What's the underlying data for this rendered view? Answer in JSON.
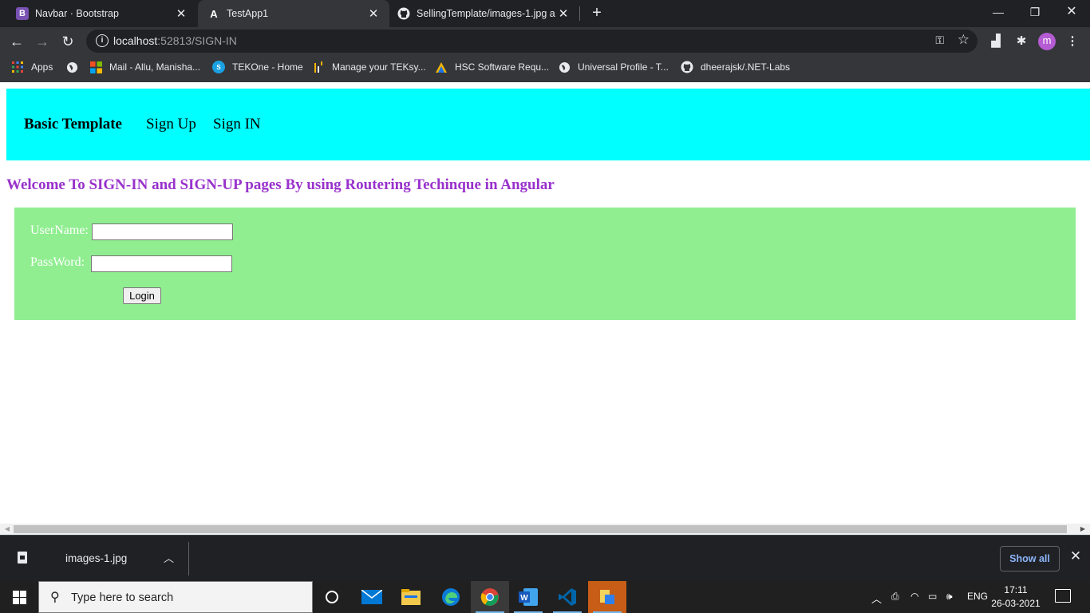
{
  "browser": {
    "tabs": [
      {
        "title": "Navbar · Bootstrap",
        "icon": "bootstrap-icon"
      },
      {
        "title": "TestApp1",
        "icon": "angular-icon"
      },
      {
        "title": "SellingTemplate/images-1.jpg at",
        "icon": "github-icon"
      }
    ],
    "url_host": "localhost",
    "url_rest": ":52813/SIGN-IN",
    "profile_initial": "m",
    "bookmarks": [
      "Apps",
      "Mail - Allu, Manisha...",
      "TEKOne - Home",
      "Manage your TEKsy...",
      "HSC Software Requ...",
      "Universal Profile - T...",
      "dheerajsk/.NET-Labs"
    ]
  },
  "page": {
    "brand": "Basic Template",
    "nav_links": [
      "Sign Up",
      "Sign IN"
    ],
    "heading": "Welcome To SIGN-IN and SIGN-UP pages By using Routering Techinque in Angular",
    "form": {
      "username_label": "UserName:",
      "password_label": "PassWord:",
      "username_value": "",
      "password_value": "",
      "login_label": "Login"
    },
    "colors": {
      "navbar": "#00ffff",
      "heading": "#9932cc",
      "form_bg": "#90ee90"
    }
  },
  "download_shelf": {
    "file_name": "images-1.jpg",
    "show_all": "Show all"
  },
  "taskbar": {
    "search_placeholder": "Type here to search",
    "language": "ENG",
    "time": "17:11",
    "date": "26-03-2021"
  }
}
